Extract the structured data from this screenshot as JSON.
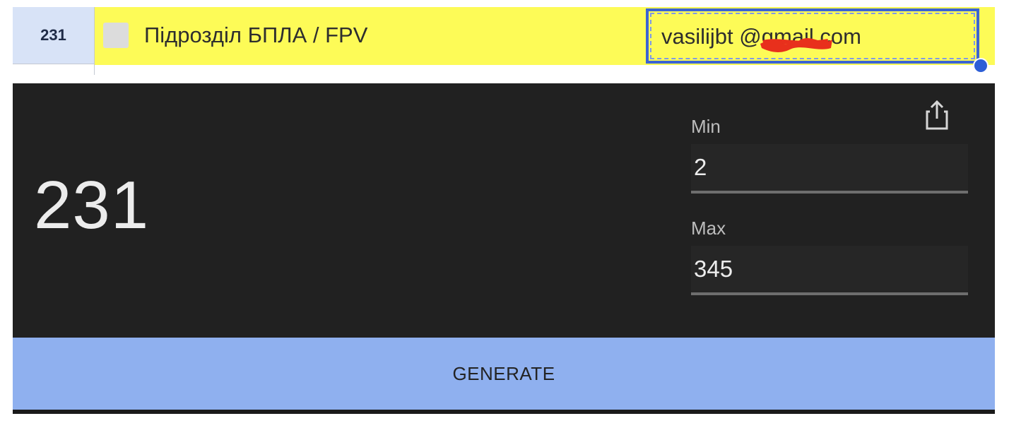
{
  "sheet": {
    "row_number": "231",
    "unit_name": "Підрозділ БПЛА / FPV",
    "email": "vasilijbt          @gmail.com",
    "colors": {
      "row_highlight": "#fdfb57",
      "row_header_bg": "#d8e3f7",
      "selection_border": "#3c64d3",
      "redaction": "#e8301c"
    }
  },
  "generator": {
    "result": "231",
    "min": {
      "label": "Min",
      "value": "2"
    },
    "max": {
      "label": "Max",
      "value": "345"
    },
    "generate_label": "GENERATE",
    "share_icon": "share-icon",
    "colors": {
      "panel_bg": "#212121",
      "button_bg": "#8fb0ef"
    }
  }
}
